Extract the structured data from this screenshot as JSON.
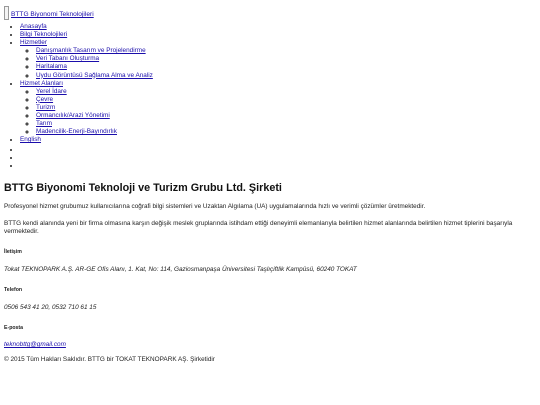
{
  "header": {
    "brand_name": "BTTG Biyonomi Teknolojileri",
    "logo_icon": "logo-image-icon"
  },
  "nav": {
    "items": [
      {
        "label": "Anasayfa"
      },
      {
        "label": "Bilgi Teknolojileri"
      },
      {
        "label": "Hizmetler",
        "children": [
          {
            "label": "Danışmanlık Tasarım ve Projelendirme"
          },
          {
            "label": "Veri Tabanı Oluşturma"
          },
          {
            "label": "Haritalama"
          },
          {
            "label": "Uydu Görüntüsü Sağlama Alma ve Analiz"
          }
        ]
      },
      {
        "label": "Hizmet Alanları",
        "children": [
          {
            "label": "Yerel İdare"
          },
          {
            "label": "Çevre"
          },
          {
            "label": "Turizm"
          },
          {
            "label": "Ormancılık/Arazi Yönetimi"
          },
          {
            "label": "Tarım"
          },
          {
            "label": "Madencilik-Enerji-Bayındırlık"
          }
        ]
      },
      {
        "label": "English"
      }
    ]
  },
  "slider_dots": [
    "",
    "",
    ""
  ],
  "main": {
    "title": "BTTG Biyonomi Teknoloji ve Turizm Grubu Ltd. Şirketi",
    "intro": "Profesyonel hizmet grubumuz kullanıcılarına coğrafi bilgi sistemleri ve Uzaktan Algılama (UA) uygulamalarında hızlı ve verimli çözümler üretmektedir.",
    "intro2": "BTTG kendi alanında yeni bir firma olmasına karşın değişik meslek gruplarında istihdam ettiği deneyimli elemanlarıyla belirtilen hizmet alanlarında belirtilen hizmet tiplerini başarıyla vermektedir."
  },
  "contact": {
    "address_label": "İletişim",
    "address": "Tokat TEKNOPARK A.Ş. AR-GE Ofis Alanı, 1. Kat, No: 114, Gaziosmanpaşa Üniversitesi Taşlıçiftlik Kampüsü, 60240 TOKAT",
    "phone_label": "Telefon",
    "phone": "0506 543 41 20, 0532 710 61 15",
    "email_label": "E-posta",
    "email": "teknobttg@gmail.com"
  },
  "footer": {
    "copyright": "© 2015 Tüm Hakları Saklıdır. BTTG bir TOKAT TEKNOPARK AŞ. Şirketidir"
  }
}
